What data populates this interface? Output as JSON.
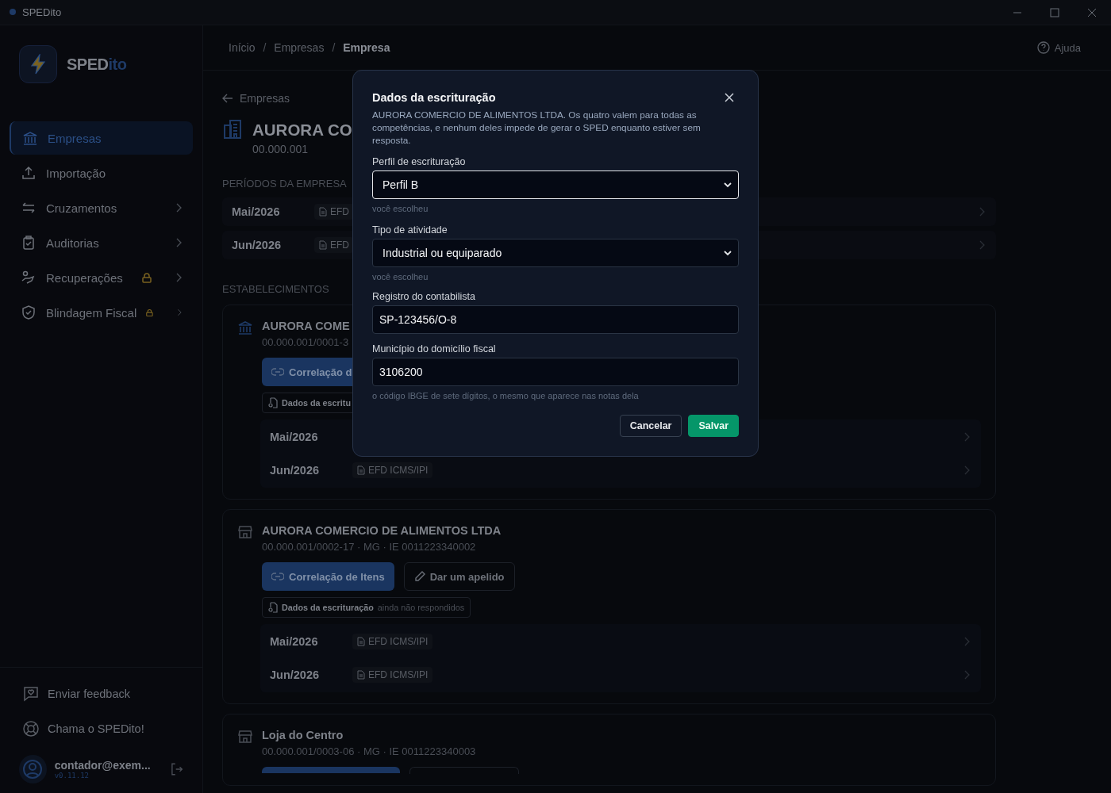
{
  "titlebar": {
    "app_name": "SPEDito"
  },
  "sidebar": {
    "brand_main": "SPED",
    "brand_accent": "ito",
    "items": [
      {
        "label": "Empresas",
        "selected": true,
        "locked": false,
        "submenu": false
      },
      {
        "label": "Importação",
        "selected": false,
        "locked": false,
        "submenu": false
      },
      {
        "label": "Cruzamentos",
        "selected": false,
        "locked": false,
        "submenu": true
      },
      {
        "label": "Auditorias",
        "selected": false,
        "locked": false,
        "submenu": true
      },
      {
        "label": "Recuperações",
        "selected": false,
        "locked": true,
        "submenu": true
      },
      {
        "label": "Blindagem Fiscal",
        "selected": false,
        "locked": true,
        "submenu": true
      }
    ],
    "footer_items": [
      "Enviar feedback",
      "Chama o SPEDito!"
    ],
    "user": {
      "email": "contador@exem...",
      "version": "v0.11.12"
    }
  },
  "header": {
    "separator": "/",
    "breadcrumb": [
      {
        "label": "Início",
        "current": false
      },
      {
        "label": "Empresas",
        "current": false
      },
      {
        "label": "Empresa",
        "current": true
      }
    ],
    "help": "Ajuda"
  },
  "page": {
    "back": "Empresas",
    "title": "AURORA CO",
    "subtitle": "00.000.001",
    "periods_heading": "PERÍODOS DA EMPRESA",
    "periods": [
      {
        "label": "Mai/2026",
        "tag": "EFD"
      },
      {
        "label": "Jun/2026",
        "tag": "EFD"
      }
    ],
    "establishments_heading": "ESTABELECIMENTOS",
    "establishments": [
      {
        "kind": "head",
        "name": "AURORA COME",
        "details": "00.000.001/0001-3",
        "actions": [
          {
            "kind": "primary",
            "label": "Correlação d"
          }
        ],
        "status": {
          "label": "Dados da escritu"
        },
        "periods": [
          {
            "label": "Mai/2026"
          },
          {
            "label": "Jun/2026",
            "tag": "EFD ICMS/IPI"
          }
        ]
      },
      {
        "kind": "branch",
        "name": "AURORA COMERCIO DE ALIMENTOS LTDA",
        "details": "00.000.001/0002-17 · MG · IE 0011223340002",
        "actions": [
          {
            "kind": "primary",
            "label": "Correlação de Itens"
          },
          {
            "kind": "secondary",
            "label": "Dar um apelido"
          }
        ],
        "status": {
          "label": "Dados da escrituração",
          "note": "ainda não respondidos"
        },
        "periods": [
          {
            "label": "Mai/2026",
            "tag": "EFD ICMS/IPI"
          },
          {
            "label": "Jun/2026",
            "tag": "EFD ICMS/IPI"
          }
        ]
      },
      {
        "kind": "branch",
        "name": "Loja do Centro",
        "details": "00.000.001/0003-06 · MG · IE 0011223340003",
        "actions": [
          {
            "kind": "primary"
          },
          {
            "kind": "secondary"
          }
        ]
      }
    ]
  },
  "modal": {
    "title": "Dados da escrituração",
    "description": "AURORA COMERCIO DE ALIMENTOS LTDA. Os quatro valem para todas as competências, e nenhum deles impede de gerar o SPED enquanto estiver sem resposta.",
    "fields": [
      {
        "kind": "select",
        "label": "Perfil de escrituração",
        "value": "Perfil B",
        "focused": true,
        "hint": "você escolheu"
      },
      {
        "kind": "select",
        "label": "Tipo de atividade",
        "value": "Industrial ou equiparado",
        "focused": false,
        "hint": "você escolheu"
      },
      {
        "kind": "input",
        "label": "Registro do contabilista",
        "value": "SP-123456/O-8",
        "focused": false
      },
      {
        "kind": "input",
        "label": "Município do domicílio fiscal",
        "value": "3106200",
        "focused": false,
        "hint": "o código IBGE de sete dígitos, o mesmo que aparece nas notas dela"
      }
    ],
    "buttons": [
      {
        "kind": "secondary",
        "label": "Cancelar"
      },
      {
        "kind": "primary",
        "label": "Salvar"
      }
    ]
  }
}
